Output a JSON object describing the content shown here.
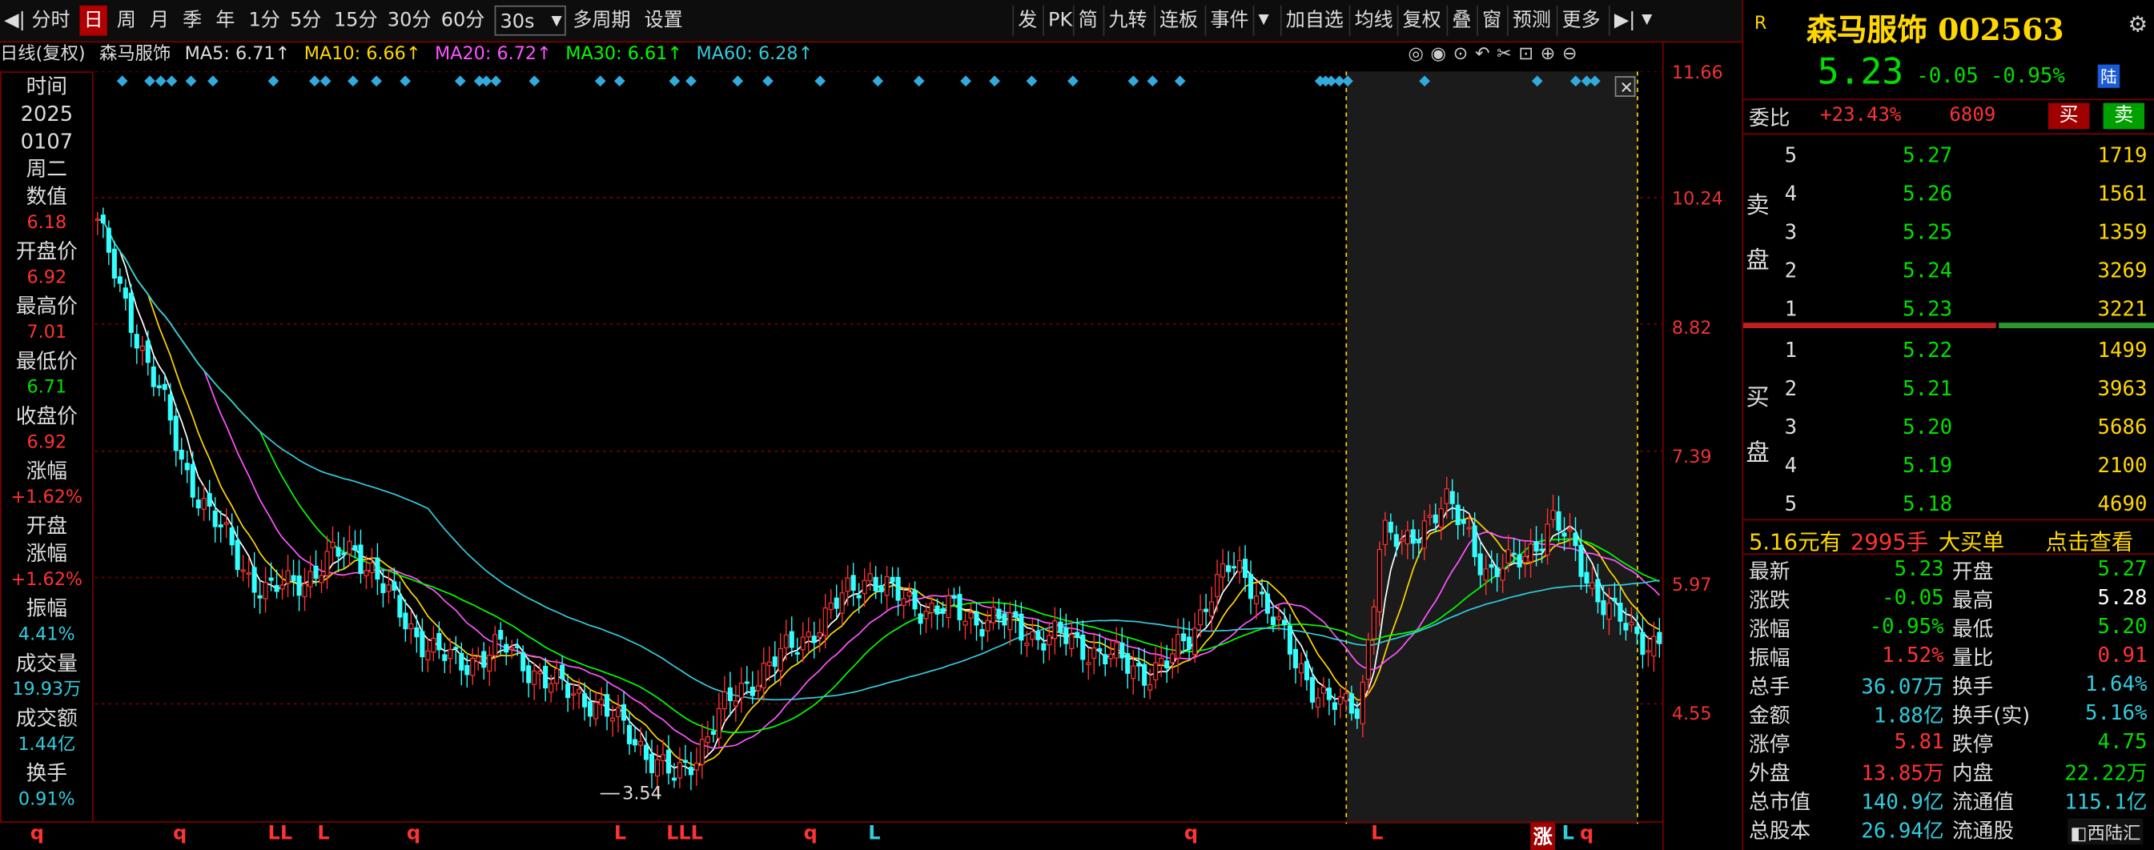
{
  "toolbar": {
    "items": [
      "分时",
      "日",
      "周",
      "月",
      "季",
      "年",
      "1分",
      "5分",
      "15分",
      "30分",
      "60分",
      "30s",
      "多周期",
      "设置"
    ],
    "right_items": [
      "发",
      "PK",
      "简",
      "九转",
      "连板",
      "事件",
      "加自选",
      "均线",
      "复权",
      "叠",
      "窗",
      "预测",
      "更多"
    ]
  },
  "ma_row": {
    "label": "日线(复权)",
    "name": "森马服饰",
    "ma5": "MA5: 6.71↑",
    "ma10": "MA10: 6.66↑",
    "ma20": "MA20: 6.72↑",
    "ma30": "MA30: 6.61↑",
    "ma60": "MA60: 6.28↑"
  },
  "left_panel": [
    {
      "label": "时间",
      "value": ""
    },
    {
      "label": "2025",
      "value": ""
    },
    {
      "label": "0107",
      "value": ""
    },
    {
      "label": "周二",
      "value": ""
    },
    {
      "label": "数值",
      "value": "6.18"
    },
    {
      "label": "开盘价",
      "value": "6.92"
    },
    {
      "label": "最高价",
      "value": "7.01"
    },
    {
      "label": "最低价",
      "value": "6.71"
    },
    {
      "label": "收盘价",
      "value": "6.92"
    },
    {
      "label": "涨幅",
      "value": "+1.62%"
    },
    {
      "label": "开盘",
      "value": ""
    },
    {
      "label": "涨幅",
      "value": "+1.62%"
    },
    {
      "label": "振幅",
      "value": "4.41%"
    },
    {
      "label": "成交量",
      "value": "19.93万"
    },
    {
      "label": "成交额",
      "value": "1.44亿"
    },
    {
      "label": "换手",
      "value": "0.91%"
    }
  ],
  "price_ticks": [
    "11.66",
    "10.24",
    "8.82",
    "7.39",
    "5.97",
    "4.55"
  ],
  "low_marker": "3.54",
  "bottom_markers": [
    "q",
    "q",
    "LL",
    "L",
    "q",
    "L",
    "LLL",
    "q",
    "L",
    "q",
    "L",
    "涨",
    "L",
    "q"
  ],
  "chart_data": {
    "type": "candlestick",
    "ylim": [
      3.2,
      11.66
    ],
    "close": [
      10.0,
      9.2,
      8.6,
      8.0,
      7.2,
      6.8,
      6.4,
      6.0,
      5.8,
      5.9,
      6.0,
      6.2,
      6.3,
      6.0,
      5.6,
      5.3,
      5.1,
      5.0,
      5.1,
      5.2,
      5.0,
      4.8,
      4.7,
      4.6,
      4.4,
      4.2,
      3.9,
      3.7,
      4.0,
      4.4,
      4.7,
      4.9,
      5.1,
      5.3,
      5.5,
      5.8,
      6.0,
      5.8,
      5.7,
      5.6,
      5.6,
      5.5,
      5.5,
      5.4,
      5.3,
      5.3,
      5.2,
      5.1,
      5.0,
      4.9,
      5.0,
      5.3,
      5.8,
      6.1,
      5.9,
      5.5,
      5.0,
      4.7,
      4.5,
      4.5,
      6.5,
      6.3,
      6.6,
      6.8,
      6.5,
      6.0,
      6.1,
      6.3,
      6.6,
      6.3,
      5.8,
      5.5,
      5.3,
      5.23
    ],
    "ma_series": [
      {
        "name": "MA5",
        "color": "#ffffff"
      },
      {
        "name": "MA10",
        "color": "#ffd700"
      },
      {
        "name": "MA20",
        "color": "#ff55ff"
      },
      {
        "name": "MA30",
        "color": "#00ff00"
      },
      {
        "name": "MA60",
        "color": "#33ccdd"
      }
    ]
  },
  "right_panel": {
    "title": "森马服饰 002563",
    "price": "5.23",
    "change": "-0.05",
    "pct": "-0.95%",
    "exchange_tag": "陆",
    "weibi_label": "委比",
    "weibi": "+23.43%",
    "weicha": "6809",
    "buy_btn": "买",
    "sell_btn": "卖",
    "sell_label": "卖盘",
    "buy_label": "买盘",
    "asks": [
      {
        "lvl": "5",
        "price": "5.27",
        "vol": "1719"
      },
      {
        "lvl": "4",
        "price": "5.26",
        "vol": "1561"
      },
      {
        "lvl": "3",
        "price": "5.25",
        "vol": "1359"
      },
      {
        "lvl": "2",
        "price": "5.24",
        "vol": "3269"
      },
      {
        "lvl": "1",
        "price": "5.23",
        "vol": "3221"
      }
    ],
    "bids": [
      {
        "lvl": "1",
        "price": "5.22",
        "vol": "1499"
      },
      {
        "lvl": "2",
        "price": "5.21",
        "vol": "3963"
      },
      {
        "lvl": "3",
        "price": "5.20",
        "vol": "5686"
      },
      {
        "lvl": "4",
        "price": "5.19",
        "vol": "2100"
      },
      {
        "lvl": "5",
        "price": "5.18",
        "vol": "4690"
      }
    ],
    "bigorder": {
      "a": "5.16元有",
      "b": "2995手",
      "c": "大买单",
      "d": "点击查看"
    },
    "stats": [
      {
        "l1": "最新",
        "v1": "5.23",
        "l2": "开盘",
        "v2": "5.27"
      },
      {
        "l1": "涨跌",
        "v1": "-0.05",
        "l2": "最高",
        "v2": "5.28"
      },
      {
        "l1": "涨幅",
        "v1": "-0.95%",
        "l2": "最低",
        "v2": "5.20"
      },
      {
        "l1": "振幅",
        "v1": "1.52%",
        "l2": "量比",
        "v2": "0.91"
      },
      {
        "l1": "总手",
        "v1": "36.07万",
        "l2": "换手",
        "v2": "1.64%"
      },
      {
        "l1": "金额",
        "v1": "1.88亿",
        "l2": "换手(实)",
        "v2": "5.16%"
      },
      {
        "l1": "涨停",
        "v1": "5.81",
        "l2": "跌停",
        "v2": "4.75"
      },
      {
        "l1": "外盘",
        "v1": "13.85万",
        "l2": "内盘",
        "v2": "22.22万"
      },
      {
        "l1": "总市值",
        "v1": "140.9亿",
        "l2": "流通值",
        "v2": "115.1亿"
      },
      {
        "l1": "总股本",
        "v1": "26.94亿",
        "l2": "流通股",
        "v2": ""
      }
    ],
    "logo": "西陆汇"
  }
}
